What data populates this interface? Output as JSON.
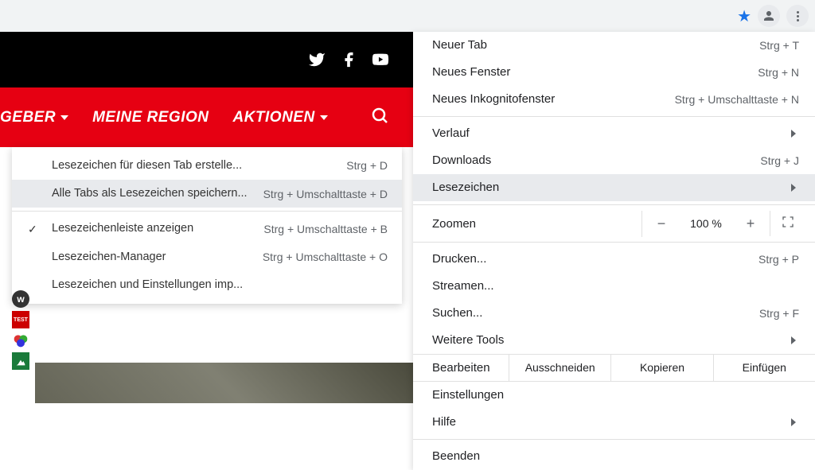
{
  "toolbar": {
    "star_title": "bookmark-star",
    "profile_title": "profile",
    "menu_title": "main-menu"
  },
  "nav": {
    "geber": "GEBER",
    "region": "MEINE REGION",
    "aktionen": "AKTIONEN"
  },
  "submenu": {
    "items": [
      {
        "label": "Lesezeichen für diesen Tab erstelle...",
        "shortcut": "Strg + D",
        "check": false,
        "hover": false
      },
      {
        "label": "Alle Tabs als Lesezeichen speichern...",
        "shortcut": "Strg + Umschalttaste + D",
        "check": false,
        "hover": true
      },
      {
        "sep": true
      },
      {
        "label": "Lesezeichenleiste anzeigen",
        "shortcut": "Strg + Umschalttaste + B",
        "check": true,
        "hover": false
      },
      {
        "label": "Lesezeichen-Manager",
        "shortcut": "Strg + Umschalttaste + O",
        "check": false,
        "hover": false
      },
      {
        "label": "Lesezeichen und Einstellungen imp...",
        "shortcut": "",
        "check": false,
        "hover": false
      }
    ]
  },
  "main_menu": {
    "new_tab": {
      "label": "Neuer Tab",
      "shortcut": "Strg + T"
    },
    "new_window": {
      "label": "Neues Fenster",
      "shortcut": "Strg + N"
    },
    "new_incognito": {
      "label": "Neues Inkognitofenster",
      "shortcut": "Strg + Umschalttaste + N"
    },
    "history": {
      "label": "Verlauf"
    },
    "downloads": {
      "label": "Downloads",
      "shortcut": "Strg + J"
    },
    "bookmarks": {
      "label": "Lesezeichen"
    },
    "zoom": {
      "label": "Zoomen",
      "minus": "−",
      "pct": "100 %",
      "plus": "+"
    },
    "print": {
      "label": "Drucken...",
      "shortcut": "Strg + P"
    },
    "cast": {
      "label": "Streamen..."
    },
    "find": {
      "label": "Suchen...",
      "shortcut": "Strg + F"
    },
    "more_tools": {
      "label": "Weitere Tools"
    },
    "edit": {
      "label": "Bearbeiten",
      "cut": "Ausschneiden",
      "copy": "Kopieren",
      "paste": "Einfügen"
    },
    "settings": {
      "label": "Einstellungen"
    },
    "help": {
      "label": "Hilfe"
    },
    "exit": {
      "label": "Beenden"
    }
  }
}
